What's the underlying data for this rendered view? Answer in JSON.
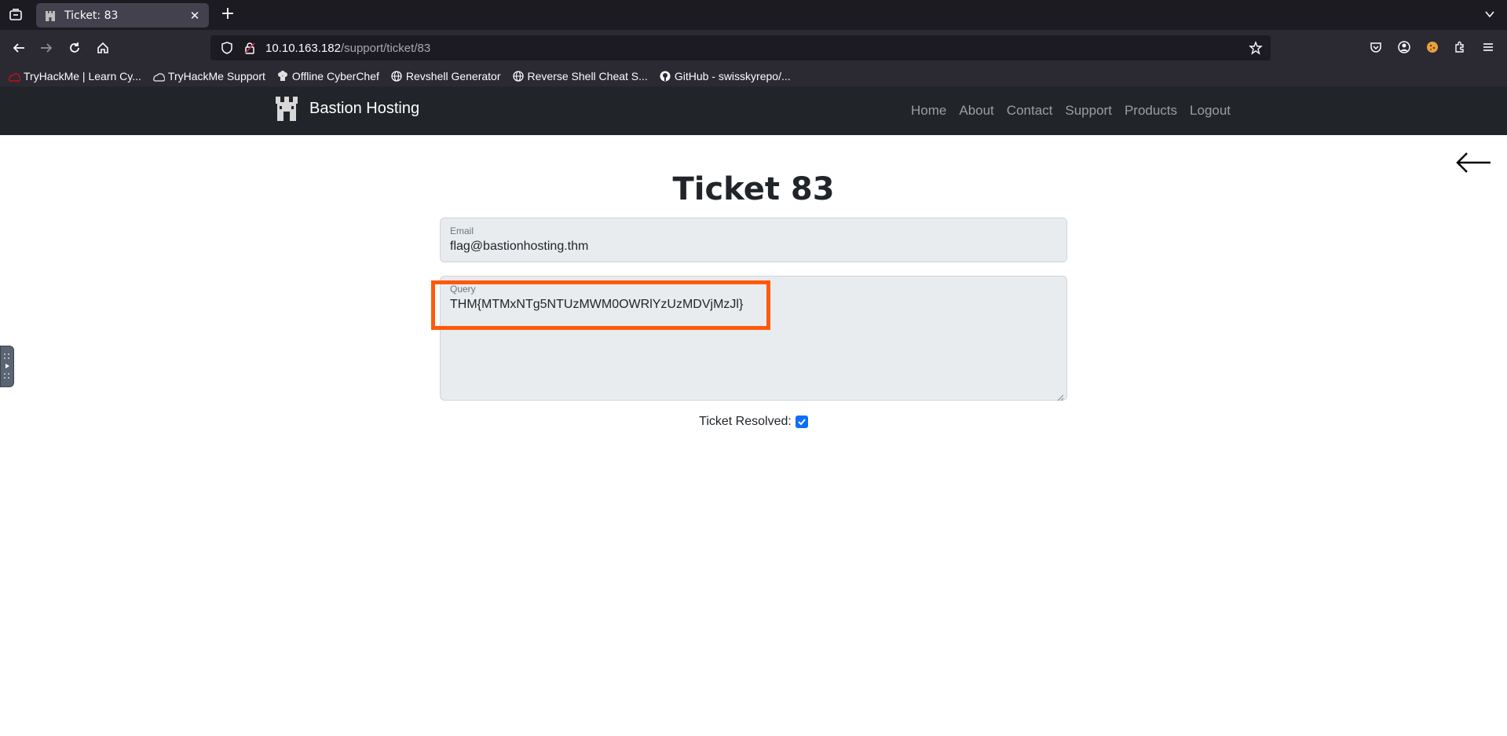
{
  "browser": {
    "tab": {
      "title": "Ticket: 83"
    },
    "url": {
      "host": "10.10.163.182",
      "path": "/support/ticket/83"
    },
    "bookmarks": [
      {
        "label": "TryHackMe | Learn Cy...",
        "icon": "tryhackme-icon"
      },
      {
        "label": "TryHackMe Support",
        "icon": "cloud-icon"
      },
      {
        "label": "Offline CyberChef",
        "icon": "chef-icon"
      },
      {
        "label": "Revshell Generator",
        "icon": "globe-icon"
      },
      {
        "label": "Reverse Shell Cheat S...",
        "icon": "globe-icon"
      },
      {
        "label": "GitHub - swisskyrepo/...",
        "icon": "github-icon"
      }
    ]
  },
  "site": {
    "brand": "Bastion Hosting",
    "nav": [
      "Home",
      "About",
      "Contact",
      "Support",
      "Products",
      "Logout"
    ]
  },
  "ticket": {
    "title": "Ticket 83",
    "email_label": "Email",
    "email_value": "flag@bastionhosting.thm",
    "query_label": "Query",
    "query_value": "THM{MTMxNTg5NTUzMWM0OWRlYzUzMDVjMzJl}",
    "resolved_label": "Ticket Resolved:",
    "resolved_checked": true
  },
  "colors": {
    "highlight": "#ff5a0a",
    "checkbox": "#0d6efd",
    "site_nav_bg": "#212529"
  }
}
